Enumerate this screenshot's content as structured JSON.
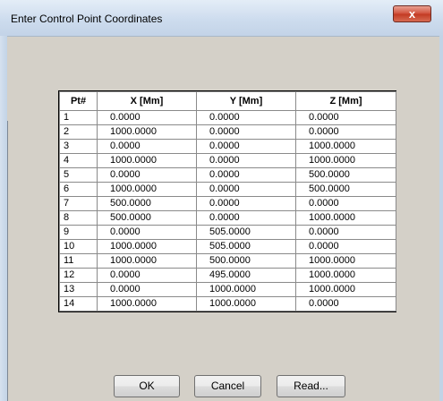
{
  "window": {
    "title": "Enter Control Point Coordinates",
    "close_glyph": "x"
  },
  "grid": {
    "columns": [
      "Pt#",
      "X [Mm]",
      "Y [Mm]",
      "Z [Mm]"
    ],
    "rows": [
      [
        "1",
        "0.0000",
        "0.0000",
        "0.0000"
      ],
      [
        "2",
        "1000.0000",
        "0.0000",
        "0.0000"
      ],
      [
        "3",
        "0.0000",
        "0.0000",
        "1000.0000"
      ],
      [
        "4",
        "1000.0000",
        "0.0000",
        "1000.0000"
      ],
      [
        "5",
        "0.0000",
        "0.0000",
        "500.0000"
      ],
      [
        "6",
        "1000.0000",
        "0.0000",
        "500.0000"
      ],
      [
        "7",
        "500.0000",
        "0.0000",
        "0.0000"
      ],
      [
        "8",
        "500.0000",
        "0.0000",
        "1000.0000"
      ],
      [
        "9",
        "0.0000",
        "505.0000",
        "0.0000"
      ],
      [
        "10",
        "1000.0000",
        "505.0000",
        "0.0000"
      ],
      [
        "11",
        "1000.0000",
        "500.0000",
        "1000.0000"
      ],
      [
        "12",
        "0.0000",
        "495.0000",
        "1000.0000"
      ],
      [
        "13",
        "0.0000",
        "1000.0000",
        "1000.0000"
      ],
      [
        "14",
        "1000.0000",
        "1000.0000",
        "0.0000"
      ]
    ]
  },
  "buttons": {
    "ok": "OK",
    "cancel": "Cancel",
    "read": "Read..."
  },
  "icons": {
    "close": "close-icon"
  },
  "colors": {
    "close_button": "#c94a33",
    "titlebar": "#cddcee",
    "dialog_background": "#d4d0c8"
  }
}
